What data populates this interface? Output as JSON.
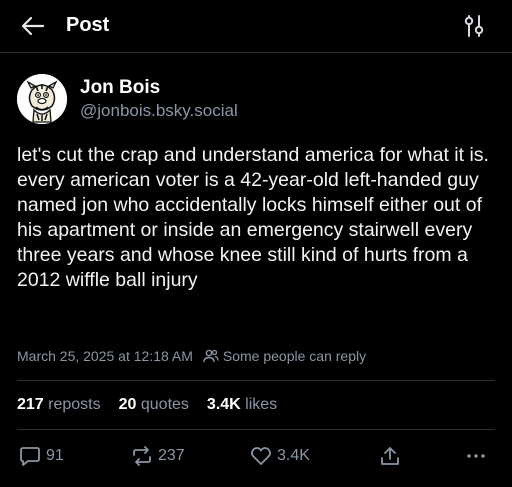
{
  "header": {
    "back_icon": "arrow-left-icon",
    "title": "Post",
    "filter_icon": "sliders-icon"
  },
  "author": {
    "display_name": "Jon Bois",
    "handle": "@jonbois.bsky.social",
    "avatar_icon": "cartoon-tiger-avatar"
  },
  "post": {
    "text": "let's cut the crap and understand america for what it is. every american voter is a 42-year-old left-handed guy named jon who accidentally locks himself either out of his apartment or inside an emergency stairwell every three years and whose knee still kind of hurts from a 2012 wiffle ball injury",
    "timestamp": "March 25, 2025 at 12:18 AM",
    "reply_setting": "Some people can reply",
    "reply_setting_icon": "people-icon"
  },
  "stats": {
    "reposts_count": "217",
    "reposts_label": "reposts",
    "quotes_count": "20",
    "quotes_label": "quotes",
    "likes_count": "3.4K",
    "likes_label": "likes"
  },
  "actions": {
    "reply_count": "91",
    "repost_count": "237",
    "like_count": "3.4K",
    "reply_icon": "speech-bubble-icon",
    "repost_icon": "repost-arrows-icon",
    "like_icon": "heart-icon",
    "share_icon": "share-icon",
    "more_icon": "ellipsis-icon"
  },
  "colors": {
    "background": "#000000",
    "text_primary": "#f1f3f5",
    "text_secondary": "#8a96a6",
    "divider": "#2b3138"
  }
}
